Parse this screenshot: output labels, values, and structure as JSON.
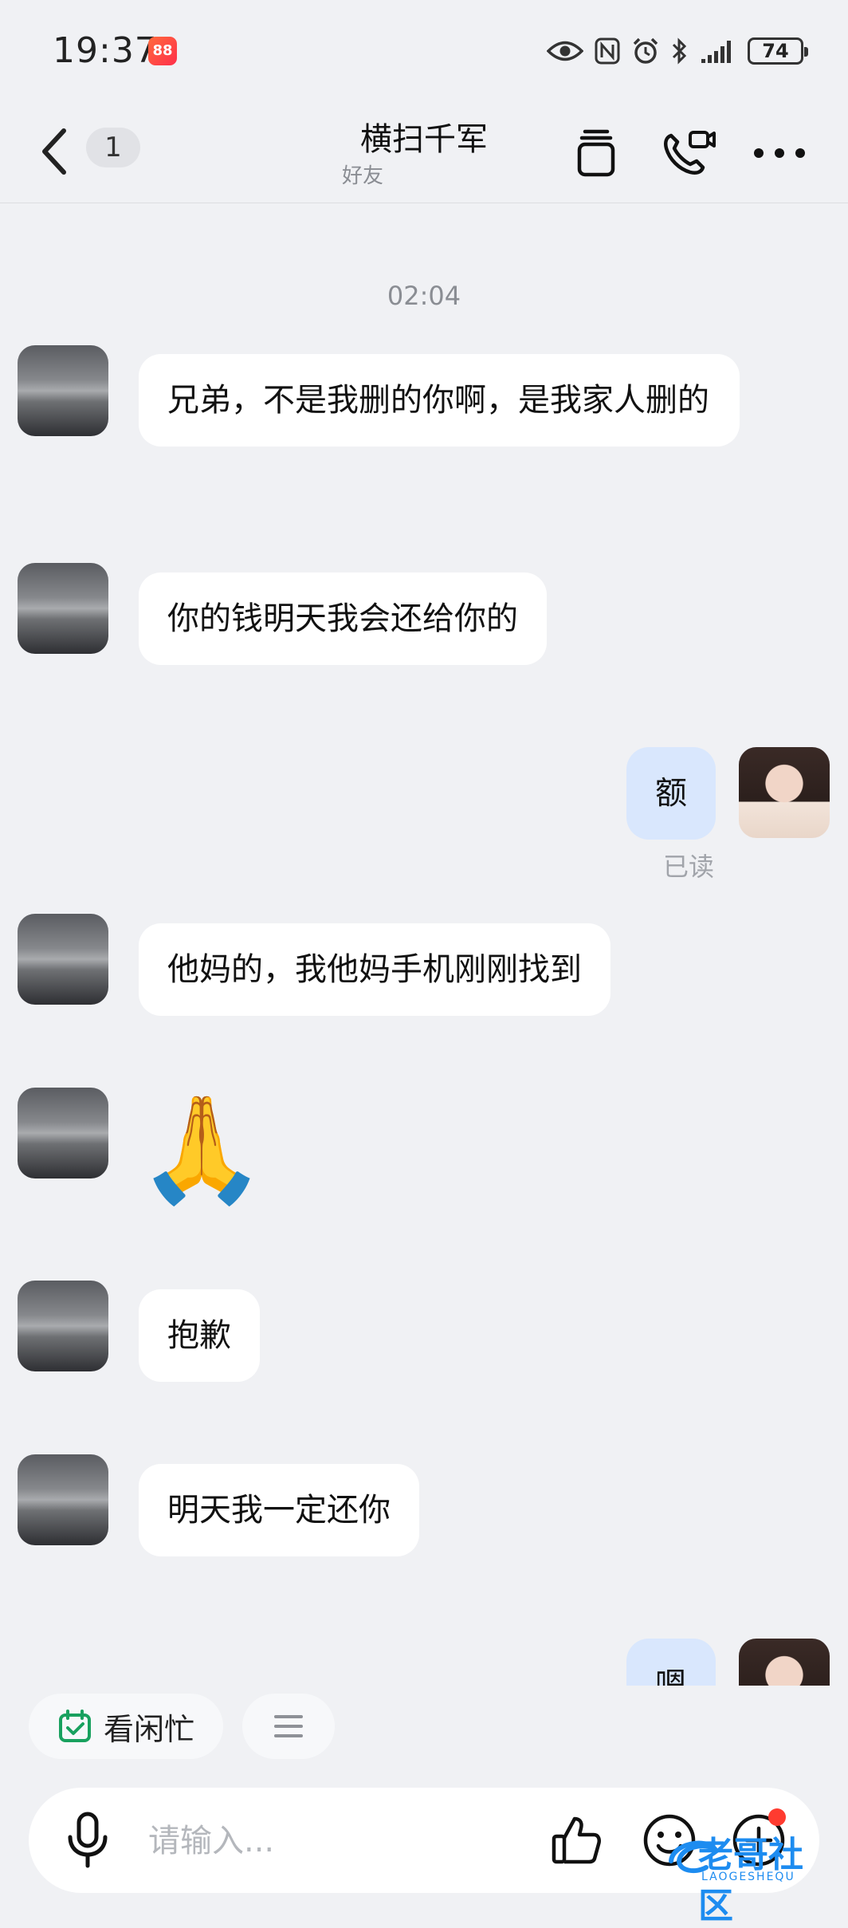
{
  "status_bar": {
    "time": "19:37",
    "app_icon_text": "88",
    "battery": "74"
  },
  "header": {
    "unread_count": "1",
    "title": "横扫千军",
    "subtitle": "好友"
  },
  "conversation": {
    "timestamp": "02:04",
    "messages": [
      {
        "from": "other",
        "text": "兄弟，不是我删的你啊，是我家人删的"
      },
      {
        "from": "other",
        "text": "你的钱明天我会还给你的"
      },
      {
        "from": "me",
        "text": "额",
        "read_status": "已读"
      },
      {
        "from": "other",
        "text": "他妈的，我他妈手机刚刚找到"
      },
      {
        "from": "other",
        "text": "🙏"
      },
      {
        "from": "other",
        "text": "抱歉"
      },
      {
        "from": "other",
        "text": "明天我一定还你"
      },
      {
        "from": "me",
        "text": "嗯"
      }
    ]
  },
  "quick_actions": {
    "availability_label": "看闲忙",
    "menu_icon": "list-icon"
  },
  "input_bar": {
    "placeholder": "请输入..."
  },
  "watermark": {
    "main": "老哥社区",
    "sub": "LAOGESHEQU"
  },
  "colors": {
    "background": "#f0f1f4",
    "bubble_other": "#ffffff",
    "bubble_me": "#d9e7fd",
    "availability_icon": "#19a15f",
    "notification_dot": "#ff3b30"
  }
}
